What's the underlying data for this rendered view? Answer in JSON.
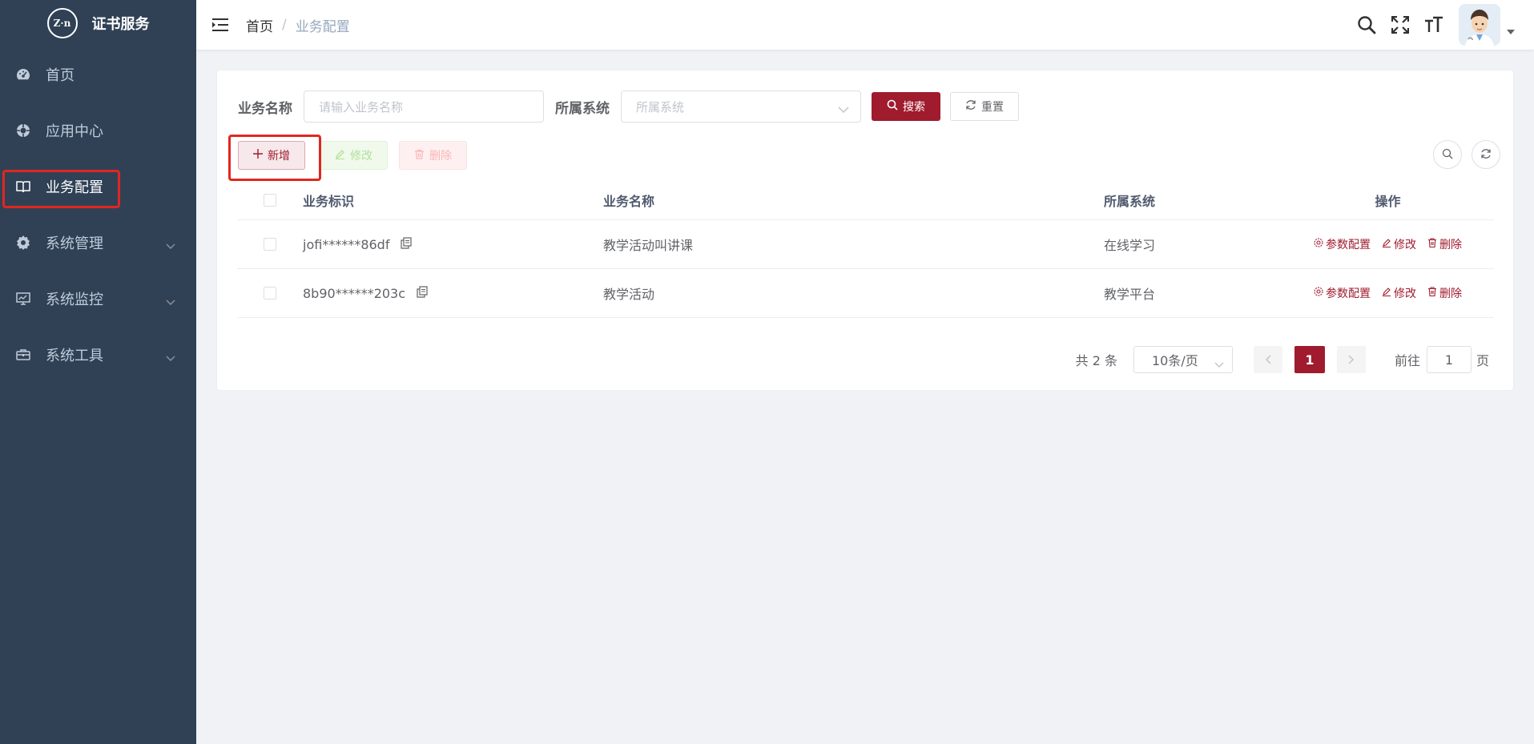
{
  "sidebar": {
    "logo_text": "Z·n",
    "title": "证书服务",
    "items": [
      {
        "label": "首页",
        "icon": "dashboard-icon",
        "has_arrow": false
      },
      {
        "label": "应用中心",
        "icon": "app-center-icon",
        "has_arrow": false
      },
      {
        "label": "业务配置",
        "icon": "book-icon",
        "has_arrow": false,
        "active": true
      },
      {
        "label": "系统管理",
        "icon": "gear-icon",
        "has_arrow": true
      },
      {
        "label": "系统监控",
        "icon": "monitor-icon",
        "has_arrow": true
      },
      {
        "label": "系统工具",
        "icon": "toolbox-icon",
        "has_arrow": true
      }
    ]
  },
  "header": {
    "breadcrumb": {
      "home": "首页",
      "separator": "/",
      "current": "业务配置"
    },
    "icons": [
      "search-icon",
      "fullscreen-icon",
      "font-size-icon"
    ]
  },
  "search": {
    "name_label": "业务名称",
    "name_placeholder": "请输入业务名称",
    "system_label": "所属系统",
    "system_placeholder": "所属系统",
    "search_btn": "搜索",
    "reset_btn": "重置"
  },
  "toolbar": {
    "add": "新增",
    "edit": "修改",
    "delete": "删除"
  },
  "table": {
    "headers": {
      "id": "业务标识",
      "name": "业务名称",
      "system": "所属系统",
      "ops": "操作"
    },
    "rows": [
      {
        "id": "jofi******86df",
        "name": "教学活动叫讲课",
        "system": "在线学习"
      },
      {
        "id": "8b90******203c",
        "name": "教学活动",
        "system": "教学平台"
      }
    ],
    "ops": {
      "config": "参数配置",
      "edit": "修改",
      "delete": "删除"
    }
  },
  "pagination": {
    "total": "共 2 条",
    "page_size": "10条/页",
    "current_page": "1",
    "goto_label": "前往",
    "goto_value": "1",
    "page_suffix": "页"
  },
  "colors": {
    "sidebar_bg": "#304156",
    "primary": "#a01b2e",
    "highlight_box": "#e0271f"
  }
}
